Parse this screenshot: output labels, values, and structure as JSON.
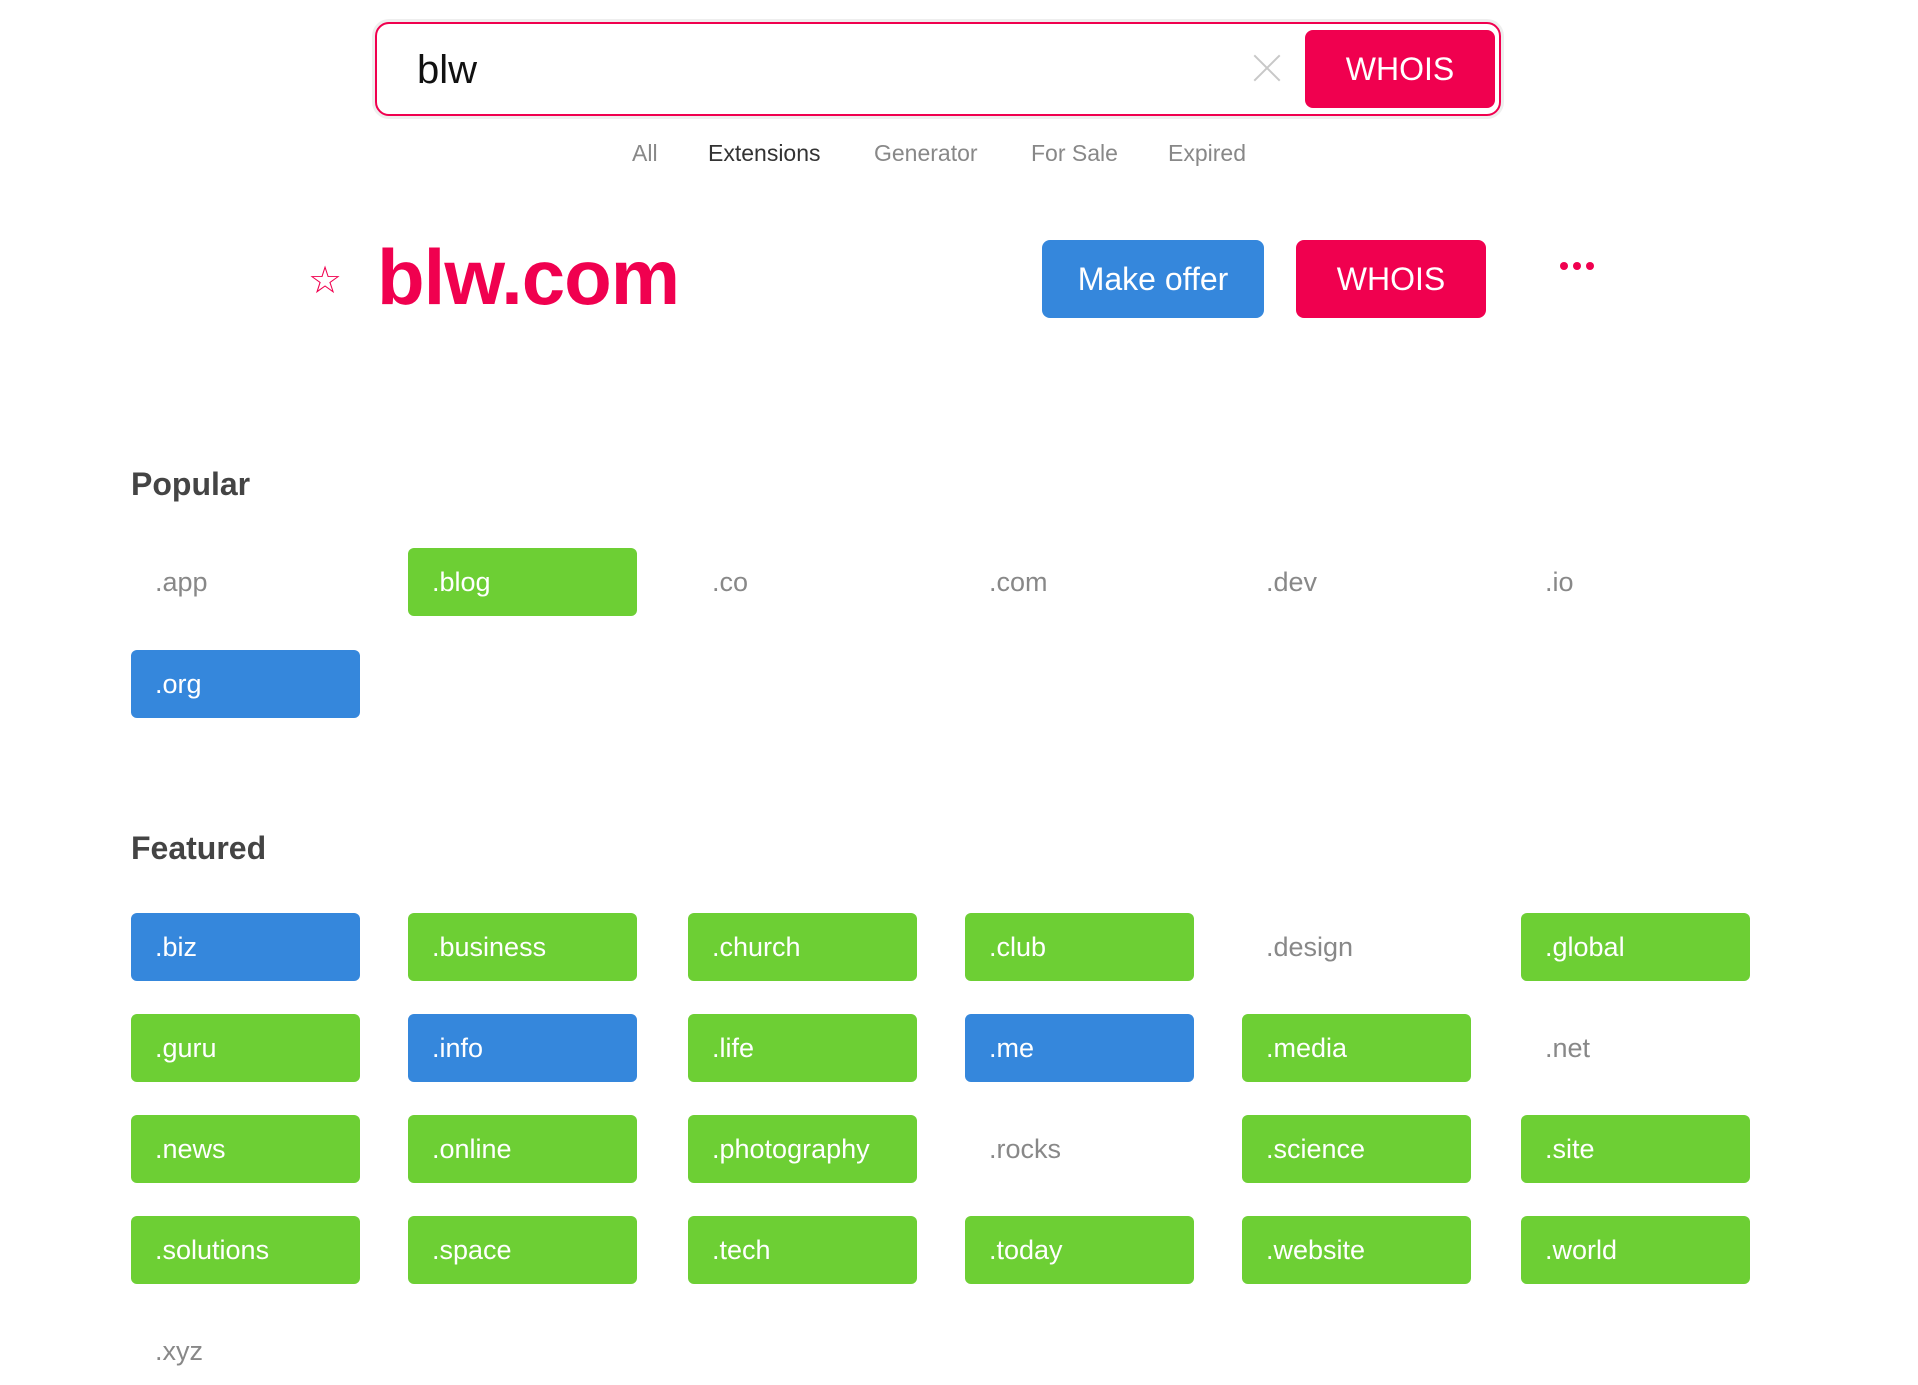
{
  "search": {
    "value": "blw",
    "button_label": "WHOIS",
    "clear_icon": "close-icon"
  },
  "tabs": [
    {
      "label": "All",
      "active": false
    },
    {
      "label": "Extensions",
      "active": true
    },
    {
      "label": "Generator",
      "active": false
    },
    {
      "label": "For Sale",
      "active": false
    },
    {
      "label": "Expired",
      "active": false
    }
  ],
  "result": {
    "star": "☆",
    "domain": "blw.com",
    "make_offer_label": "Make offer",
    "whois_label": "WHOIS",
    "more_icon": "more-horizontal-icon"
  },
  "colors": {
    "accent": "#f0004f",
    "available": "#6dcf34",
    "for_sale": "#3587dc",
    "taken_text": "#888888"
  },
  "popular": {
    "heading": "Popular",
    "items": [
      {
        "label": ".app",
        "status": "taken"
      },
      {
        "label": ".blog",
        "status": "green"
      },
      {
        "label": ".co",
        "status": "taken"
      },
      {
        "label": ".com",
        "status": "taken"
      },
      {
        "label": ".dev",
        "status": "taken"
      },
      {
        "label": ".io",
        "status": "taken"
      },
      {
        "label": ".org",
        "status": "blue"
      }
    ]
  },
  "featured": {
    "heading": "Featured",
    "items": [
      {
        "label": ".biz",
        "status": "blue"
      },
      {
        "label": ".business",
        "status": "green"
      },
      {
        "label": ".church",
        "status": "green"
      },
      {
        "label": ".club",
        "status": "green"
      },
      {
        "label": ".design",
        "status": "taken"
      },
      {
        "label": ".global",
        "status": "green"
      },
      {
        "label": ".guru",
        "status": "green"
      },
      {
        "label": ".info",
        "status": "blue"
      },
      {
        "label": ".life",
        "status": "green"
      },
      {
        "label": ".me",
        "status": "blue"
      },
      {
        "label": ".media",
        "status": "green"
      },
      {
        "label": ".net",
        "status": "taken"
      },
      {
        "label": ".news",
        "status": "green"
      },
      {
        "label": ".online",
        "status": "green"
      },
      {
        "label": ".photography",
        "status": "green"
      },
      {
        "label": ".rocks",
        "status": "taken"
      },
      {
        "label": ".science",
        "status": "green"
      },
      {
        "label": ".site",
        "status": "green"
      },
      {
        "label": ".solutions",
        "status": "green"
      },
      {
        "label": ".space",
        "status": "green"
      },
      {
        "label": ".tech",
        "status": "green"
      },
      {
        "label": ".today",
        "status": "green"
      },
      {
        "label": ".website",
        "status": "green"
      },
      {
        "label": ".world",
        "status": "green"
      },
      {
        "label": ".xyz",
        "status": "taken"
      }
    ]
  }
}
